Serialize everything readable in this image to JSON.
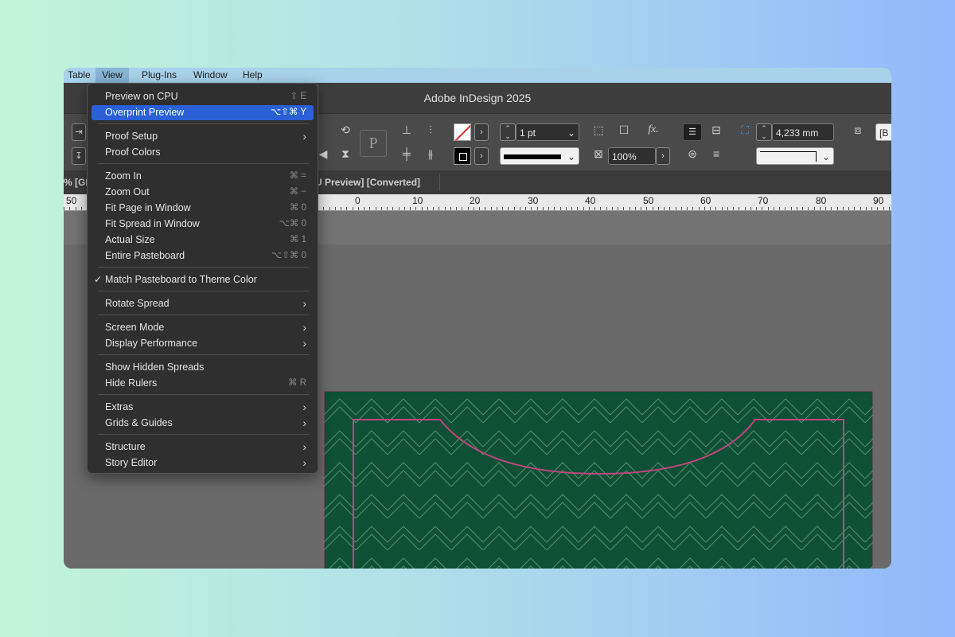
{
  "menubar": {
    "items": [
      "Table",
      "View",
      "Plug-Ins",
      "Window",
      "Help"
    ],
    "active": "View"
  },
  "window": {
    "title": "Adobe InDesign 2025"
  },
  "control_bar": {
    "stroke_weight": "1 pt",
    "stroke_value": "4,233 mm",
    "opacity": "100%",
    "placeholder_glyph": "P",
    "fx_label": "fx.",
    "cut_label": "[B"
  },
  "tabs": [
    {
      "label": "% [GPU"
    },
    {
      "label": "U Preview] [Converted]"
    }
  ],
  "ruler": {
    "labels": [
      "50",
      "0",
      "10",
      "20",
      "30",
      "40",
      "50",
      "60",
      "70",
      "80",
      "90"
    ]
  },
  "view_menu": {
    "items": [
      {
        "label": "Preview on CPU",
        "shortcut": "⇧ E",
        "submenu": false
      },
      {
        "label": "Overprint Preview",
        "shortcut": "⌥⇧⌘ Y",
        "submenu": false,
        "highlighted": true
      },
      {
        "label": "Proof Setup",
        "shortcut": "",
        "submenu": true
      },
      {
        "label": "Proof Colors",
        "shortcut": "",
        "submenu": false
      },
      {
        "label": "Zoom In",
        "shortcut": "⌘ =",
        "submenu": false
      },
      {
        "label": "Zoom Out",
        "shortcut": "⌘ −",
        "submenu": false
      },
      {
        "label": "Fit Page in Window",
        "shortcut": "⌘ 0",
        "submenu": false
      },
      {
        "label": "Fit Spread in Window",
        "shortcut": "⌥⌘ 0",
        "submenu": false
      },
      {
        "label": "Actual Size",
        "shortcut": "⌘ 1",
        "submenu": false
      },
      {
        "label": "Entire Pasteboard",
        "shortcut": "⌥⇧⌘ 0",
        "submenu": false
      },
      {
        "label": "Match Pasteboard to Theme Color",
        "shortcut": "",
        "submenu": false,
        "checked": true
      },
      {
        "label": "Rotate Spread",
        "shortcut": "",
        "submenu": true
      },
      {
        "label": "Screen Mode",
        "shortcut": "",
        "submenu": true
      },
      {
        "label": "Display Performance",
        "shortcut": "",
        "submenu": true
      },
      {
        "label": "Show Hidden Spreads",
        "shortcut": "",
        "submenu": false
      },
      {
        "label": "Hide Rulers",
        "shortcut": "⌘ R",
        "submenu": false
      },
      {
        "label": "Extras",
        "shortcut": "",
        "submenu": true
      },
      {
        "label": "Grids & Guides",
        "shortcut": "",
        "submenu": true
      },
      {
        "label": "Structure",
        "shortcut": "",
        "submenu": true
      },
      {
        "label": "Story Editor",
        "shortcut": "",
        "submenu": true
      }
    ]
  },
  "colors": {
    "highlight": "#2a5fd6",
    "page_fill": "#0e5136",
    "guide_magenta": "#c0457f",
    "pattern_line": "#5a8a6a"
  }
}
